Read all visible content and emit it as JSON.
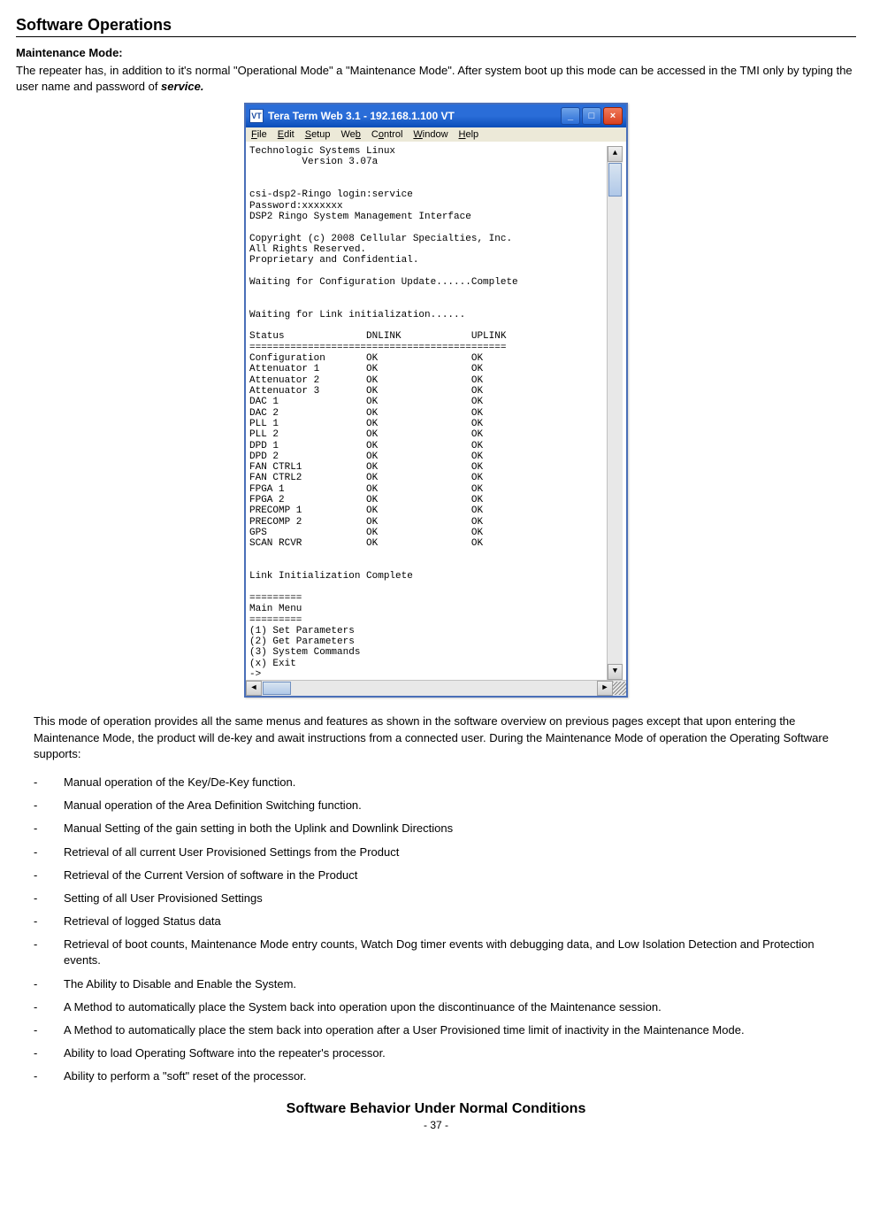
{
  "title": "Software Operations",
  "subhead": "Maintenance Mode:",
  "intro": "The repeater has, in addition to it's normal \"Operational Mode\" a \"Maintenance Mode\".  After system boot up this mode can be accessed in the TMI only by typing the user name and password of ",
  "intro_bold": "service.",
  "window": {
    "title": "Tera Term Web 3.1 - 192.168.1.100 VT",
    "menus": [
      "File",
      "Edit",
      "Setup",
      "Web",
      "Control",
      "Window",
      "Help"
    ],
    "lines": [
      "Technologic Systems Linux",
      "         Version 3.07a",
      "",
      "",
      "csi-dsp2-Ringo login:service",
      "Password:xxxxxxx",
      "DSP2 Ringo System Management Interface",
      "",
      "Copyright (c) 2008 Cellular Specialties, Inc.",
      "All Rights Reserved.",
      "Proprietary and Confidential.",
      "",
      "Waiting for Configuration Update......Complete",
      "",
      "",
      "Waiting for Link initialization......",
      "",
      "Status              DNLINK            UPLINK",
      "============================================",
      "Configuration       OK                OK",
      "Attenuator 1        OK                OK",
      "Attenuator 2        OK                OK",
      "Attenuator 3        OK                OK",
      "DAC 1               OK                OK",
      "DAC 2               OK                OK",
      "PLL 1               OK                OK",
      "PLL 2               OK                OK",
      "DPD 1               OK                OK",
      "DPD 2               OK                OK",
      "FAN CTRL1           OK                OK",
      "FAN CTRL2           OK                OK",
      "FPGA 1              OK                OK",
      "FPGA 2              OK                OK",
      "PRECOMP 1           OK                OK",
      "PRECOMP 2           OK                OK",
      "GPS                 OK                OK",
      "SCAN RCVR           OK                OK",
      "",
      "",
      "Link Initialization Complete",
      "",
      "=========",
      "Main Menu",
      "=========",
      "(1) Set Parameters",
      "(2) Get Parameters",
      "(3) System Commands",
      "(x) Exit",
      "->"
    ]
  },
  "para2": "This mode of operation provides all the same menus and features as shown in the software overview on previous pages except that upon entering the Maintenance Mode, the product will de-key and await instructions from a connected user.  During the Maintenance Mode of operation the Operating Software supports:",
  "bullets": [
    "Manual operation of the Key/De-Key function.",
    "Manual operation of the Area Definition Switching function.",
    "Manual Setting of the gain setting in both the Uplink and Downlink Directions",
    "Retrieval of all current User Provisioned Settings from the Product",
    "Retrieval of the Current Version of software in the Product",
    "Setting of all User Provisioned Settings",
    "Retrieval of logged Status data",
    "Retrieval of boot counts, Maintenance Mode entry counts, Watch Dog timer events with debugging data, and Low Isolation Detection and Protection events.",
    "The Ability to Disable and Enable the System.",
    "A Method to automatically place the System back into operation upon the discontinuance of the Maintenance session.",
    "A Method to automatically place the stem back into operation after a User Provisioned time limit of inactivity in the Maintenance Mode.",
    "Ability to load Operating Software into the repeater's processor.",
    "Ability to perform a \"soft\" reset of the processor."
  ],
  "footer_title": "Software Behavior Under Normal Conditions",
  "page_number": "- 37 -"
}
